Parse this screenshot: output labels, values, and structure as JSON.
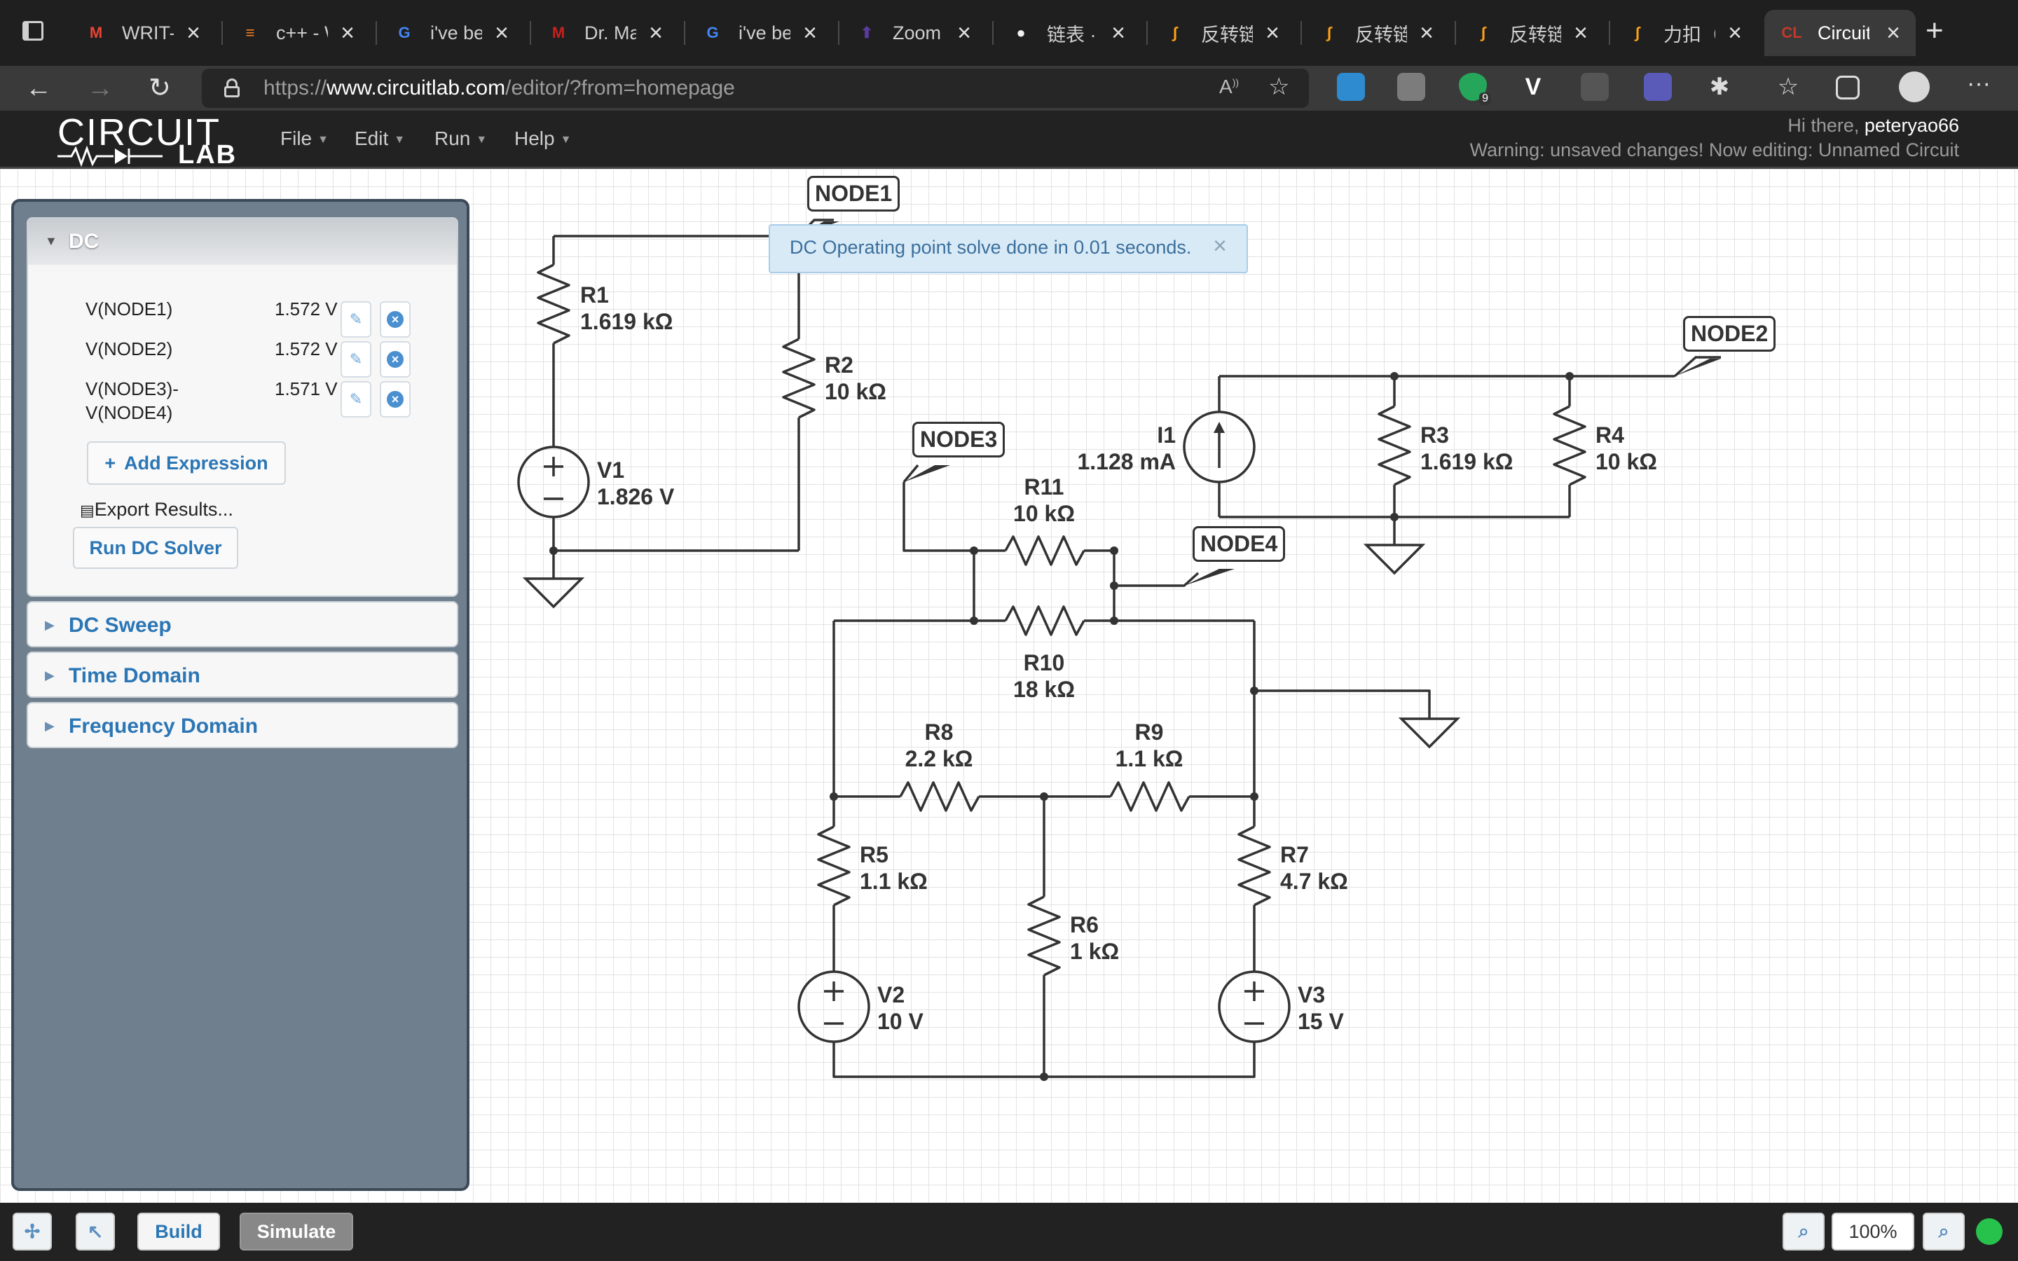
{
  "browser": {
    "tabs": [
      {
        "title": "WRIT-S",
        "icon": "gmail-icon",
        "icon_glyph": "M",
        "icon_color": "#ea4335"
      },
      {
        "title": "c++ - W",
        "icon": "stackoverflow-icon",
        "icon_glyph": "≡",
        "icon_color": "#f48024"
      },
      {
        "title": "i've bee",
        "icon": "google-icon",
        "icon_glyph": "G",
        "icon_color": "#4285f4"
      },
      {
        "title": "Dr. Mar",
        "icon": "gmail-icon",
        "icon_glyph": "M",
        "icon_color": "#c5221f"
      },
      {
        "title": "i've bee",
        "icon": "google-icon",
        "icon_glyph": "G",
        "icon_color": "#4285f4"
      },
      {
        "title": "Zoom -",
        "icon": "zoom-icon",
        "icon_glyph": "⬆",
        "icon_color": "#5b3a9c"
      },
      {
        "title": "链表 · S",
        "icon": "github-icon",
        "icon_glyph": "●",
        "icon_color": "#f0f0f0"
      },
      {
        "title": "反转链表",
        "icon": "leetcode-icon",
        "icon_glyph": "∫",
        "icon_color": "#ffa116"
      },
      {
        "title": "反转链表",
        "icon": "leetcode-icon",
        "icon_glyph": "∫",
        "icon_color": "#ffa116"
      },
      {
        "title": "反转链表",
        "icon": "leetcode-icon",
        "icon_glyph": "∫",
        "icon_color": "#ffa116"
      },
      {
        "title": "力扣（L",
        "icon": "leetcode-icon",
        "icon_glyph": "∫",
        "icon_color": "#ffa116"
      },
      {
        "title": "CircuitL",
        "icon": "circuitlab-icon",
        "icon_glyph": "CL",
        "icon_color": "#c0392b"
      }
    ],
    "url_prefix": "https://",
    "url_host": "www.circuitlab.com",
    "url_path": "/editor/?from=homepage",
    "extension_badge": "9"
  },
  "app": {
    "logo_top": "CIRCUIT",
    "logo_bottom": "LAB",
    "menus": [
      "File",
      "Edit",
      "Run",
      "Help"
    ],
    "greeting_prefix": "Hi there, ",
    "username": "peteryao66",
    "warning": "Warning: unsaved changes! Now editing: Unnamed Circuit"
  },
  "panel": {
    "dc_title": "DC",
    "expressions": [
      {
        "label_line1": "V(NODE1)",
        "label_line2": "",
        "value": "1.572 V"
      },
      {
        "label_line1": "V(NODE2)",
        "label_line2": "",
        "value": "1.572 V"
      },
      {
        "label_line1": "V(NODE3)-",
        "label_line2": "V(NODE4)",
        "value": "1.571 V"
      }
    ],
    "add_expression": "Add Expression",
    "export_results": "Export Results...",
    "run_dc_solver": "Run DC Solver",
    "collapsed_sections": [
      "DC Sweep",
      "Time Domain",
      "Frequency Domain"
    ]
  },
  "notice": {
    "text": "DC Operating point solve done in 0.01 seconds.",
    "close": "×"
  },
  "circuit": {
    "nodes": [
      "NODE1",
      "NODE2",
      "NODE3",
      "NODE4"
    ],
    "components": {
      "R1": {
        "name": "R1",
        "value": "1.619 kΩ"
      },
      "R2": {
        "name": "R2",
        "value": "10 kΩ"
      },
      "V1": {
        "name": "V1",
        "value": "1.826 V"
      },
      "I1": {
        "name": "I1",
        "value": "1.128 mA"
      },
      "R3": {
        "name": "R3",
        "value": "1.619 kΩ"
      },
      "R4": {
        "name": "R4",
        "value": "10 kΩ"
      },
      "R11": {
        "name": "R11",
        "value": "10 kΩ"
      },
      "R10": {
        "name": "R10",
        "value": "18 kΩ"
      },
      "R8": {
        "name": "R8",
        "value": "2.2 kΩ"
      },
      "R9": {
        "name": "R9",
        "value": "1.1 kΩ"
      },
      "R5": {
        "name": "R5",
        "value": "1.1 kΩ"
      },
      "R6": {
        "name": "R6",
        "value": "1 kΩ"
      },
      "R7": {
        "name": "R7",
        "value": "4.7 kΩ"
      },
      "V2": {
        "name": "V2",
        "value": "10 V"
      },
      "V3": {
        "name": "V3",
        "value": "15 V"
      }
    }
  },
  "bottombar": {
    "build": "Build",
    "simulate": "Simulate",
    "zoom": "100%"
  },
  "colors": {
    "accent": "#2b76b5",
    "panel": "#6f7f8d",
    "header": "#222222",
    "status_ok": "#27c24c"
  }
}
